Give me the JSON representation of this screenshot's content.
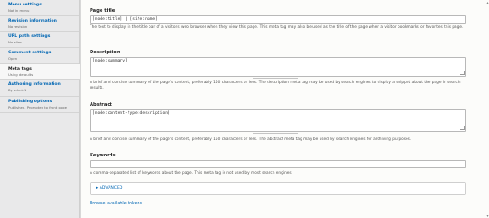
{
  "sidebar": {
    "items": [
      {
        "title": "Menu settings",
        "summary": "Not in menu"
      },
      {
        "title": "Revision information",
        "summary": "No revision"
      },
      {
        "title": "URL path settings",
        "summary": "No alias"
      },
      {
        "title": "Comment settings",
        "summary": "Open"
      },
      {
        "title": "Meta tags",
        "summary": "Using defaults"
      },
      {
        "title": "Authoring information",
        "summary": "By admin1"
      },
      {
        "title": "Publishing options",
        "summary": "Published, Promoted to front page"
      }
    ]
  },
  "meta": {
    "page_title": {
      "label": "Page title",
      "value": "[node:title] | [site:name]",
      "description": "The text to display in the title bar of a visitor's web browser when they view this page. This meta tag may also be used as the title of the page when a visitor bookmarks or favorites this page."
    },
    "description": {
      "label": "Description",
      "value": "[node:summary]",
      "description": "A brief and concise summary of the page's content, preferably 150 characters or less. The description meta tag may be used by search engines to display a snippet about the page in search results."
    },
    "abstract": {
      "label": "Abstract",
      "value": "[node:content-type:description]",
      "description": "A brief and concise summary of the page's content, preferably 150 characters or less. The abstract meta tag may be used by search engines for archiving purposes."
    },
    "keywords": {
      "label": "Keywords",
      "value": "",
      "description": "A comma-separated list of keywords about the page. This meta tag is not used by most search engines."
    },
    "advanced_label": "▸ ADVANCED",
    "browse_link": "Browse available tokens."
  }
}
